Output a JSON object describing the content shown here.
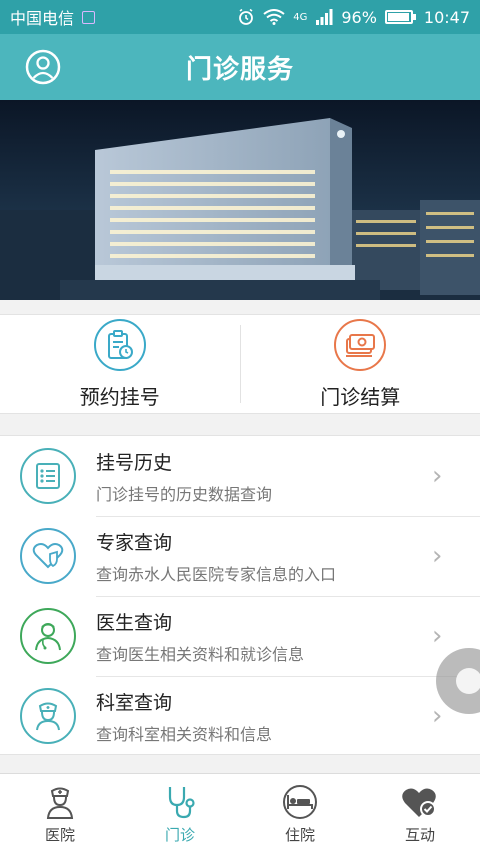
{
  "status_bar": {
    "carrier": "中国电信",
    "network": "4G",
    "battery": "96%",
    "time": "10:47"
  },
  "header": {
    "title": "门诊服务",
    "profile_icon": "user-circle-icon"
  },
  "quick_actions": [
    {
      "label": "预约挂号",
      "icon": "appointment-clipboard-icon",
      "color": "#3aa9c8"
    },
    {
      "label": "门诊结算",
      "icon": "cash-payment-icon",
      "color": "#e8774a"
    }
  ],
  "services": [
    {
      "title": "挂号历史",
      "subtitle": "门诊挂号的历史数据查询",
      "icon": "list-icon",
      "color": "#49b0b8"
    },
    {
      "title": "专家查询",
      "subtitle": "查询赤水人民医院专家信息的入口",
      "icon": "heart-shield-icon",
      "color": "#49a9c9"
    },
    {
      "title": "医生查询",
      "subtitle": "查询医生相关资料和就诊信息",
      "icon": "doctor-icon",
      "color": "#3ea85a"
    },
    {
      "title": "科室查询",
      "subtitle": "查询科室相关资料和信息",
      "icon": "nurse-icon",
      "color": "#49b0b8"
    }
  ],
  "tabs": [
    {
      "label": "医院",
      "icon": "hospital-nurse-icon",
      "active": false
    },
    {
      "label": "门诊",
      "icon": "stethoscope-icon",
      "active": true
    },
    {
      "label": "住院",
      "icon": "bed-icon",
      "active": false
    },
    {
      "label": "互动",
      "icon": "heart-check-icon",
      "active": false
    }
  ],
  "colors": {
    "primary": "#4cb6bd",
    "status_bar": "#2fa1a8",
    "active_tab": "#3aa9b0"
  }
}
